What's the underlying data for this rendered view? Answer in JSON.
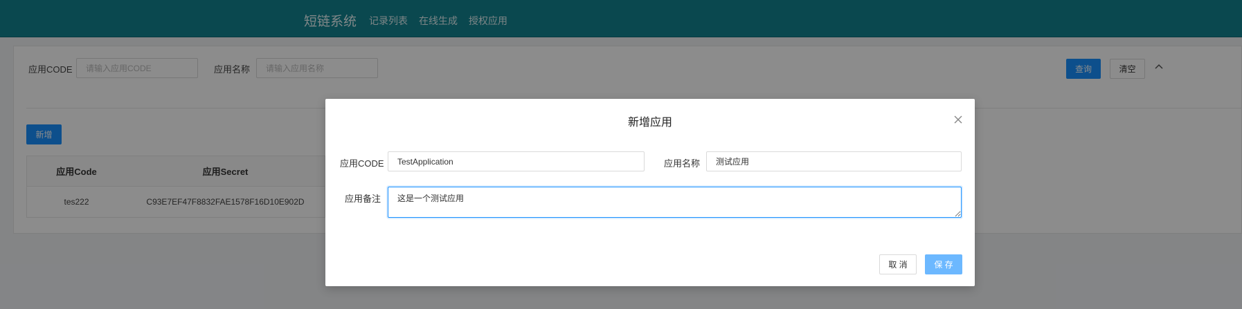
{
  "header": {
    "brand": "短链系统",
    "nav": [
      "记录列表",
      "在线生成",
      "授权应用"
    ]
  },
  "search": {
    "code_label": "应用CODE",
    "code_placeholder": "请输入应用CODE",
    "name_label": "应用名称",
    "name_placeholder": "请输入应用名称",
    "query_label": "查询",
    "clear_label": "清空",
    "collapse_icon": "chevron-up-icon"
  },
  "toolbar": {
    "add_label": "新增"
  },
  "table": {
    "columns": [
      "应用Code",
      "应用Secret"
    ],
    "rows": [
      [
        "tes222",
        "C93E7EF47F8832FAE1578F16D10E902D"
      ]
    ]
  },
  "modal": {
    "title": "新增应用",
    "code_label": "应用CODE",
    "code_value": "TestApplication",
    "name_label": "应用名称",
    "name_value": "测试应用",
    "remark_label": "应用备注",
    "remark_value": "这是一个测试应用",
    "cancel_label": "取 消",
    "save_label": "保 存",
    "close_icon": "close-icon"
  },
  "colors": {
    "header": "#138391",
    "primary": "#1890ff",
    "save": "#6cb8ff"
  }
}
